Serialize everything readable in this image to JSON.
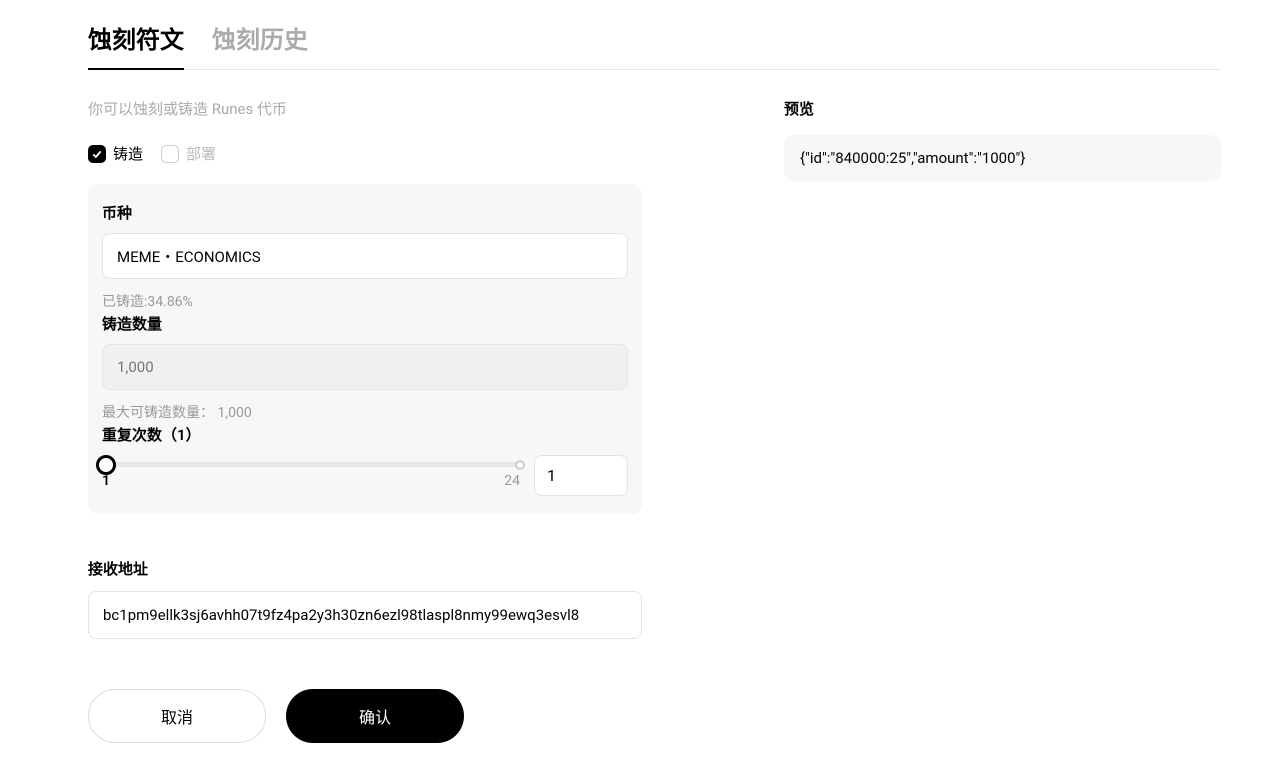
{
  "tabs": {
    "etch": "蚀刻符文",
    "history": "蚀刻历史"
  },
  "left": {
    "description": "你可以蚀刻或铸造 Runes 代币",
    "modes": {
      "mint": "铸造",
      "deploy": "部署"
    },
    "form": {
      "coin_label": "币种",
      "coin_value": "MEME・ECONOMICS",
      "minted_hint": "已铸造:34.86%",
      "amount_label": "铸造数量",
      "amount_placeholder": "1,000",
      "max_hint": "最大可铸造数量： 1,000",
      "repeat_label": "重复次数（1）",
      "slider_min": "1",
      "slider_max": "24",
      "repeat_value": "1"
    },
    "address": {
      "label": "接收地址",
      "value": "bc1pm9ellk3sj6avhh07t9fz4pa2y3h30zn6ezl98tlaspl8nmy99ewq3esvl8"
    },
    "buttons": {
      "cancel": "取消",
      "confirm": "确认"
    }
  },
  "right": {
    "preview_label": "预览",
    "preview_content": "{\"id\":\"840000:25\",\"amount\":\"1000\"}"
  }
}
